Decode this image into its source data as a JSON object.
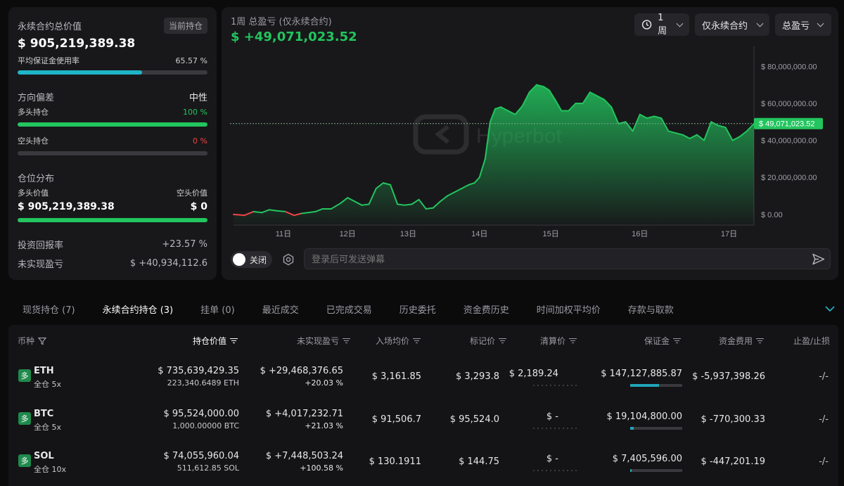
{
  "account": {
    "total_label": "永续合约总价值",
    "badge": "当前持仓",
    "total_value": "$ 905,219,389.38",
    "margin_label": "平均保证金使用率",
    "margin_pct": "65.57 %",
    "margin_fraction": 0.6557,
    "direction_label": "方向偏差",
    "direction_value": "中性",
    "long_label": "多头持仓",
    "long_pct": "100 %",
    "long_fraction": 1.0,
    "short_label": "空头持仓",
    "short_pct": "0 %",
    "short_fraction": 0.0,
    "dist_label": "仓位分布",
    "long_value_label": "多头价值",
    "short_value_label": "空头价值",
    "long_value": "$ 905,219,389.38",
    "short_value": "$ 0",
    "roi_label": "投资回报率",
    "roi_value": "+23.57 %",
    "upnl_label": "未实现盈亏",
    "upnl_value": "$ +40,934,112.6"
  },
  "chart_header": {
    "subtitle": "1周 总盈亏 (仅永续合约)",
    "value": "$ +49,071,023.52",
    "period": "1周",
    "scope": "仅永续合约",
    "metric": "总盈亏",
    "watermark": "Hyperbot",
    "current_tag": "$ 49,071,023.52"
  },
  "chart_data": {
    "type": "area",
    "ylim": [
      -5000000,
      90000000
    ],
    "yticks": [
      "$ 80,000,000.00",
      "$ 60,000,000.00",
      "$ 40,000,000.00",
      "$ 20,000,000.00",
      "$ 0.00"
    ],
    "ytick_values": [
      80000000,
      60000000,
      40000000,
      20000000,
      0
    ],
    "xticks": [
      "11日",
      "12日",
      "13日",
      "14日",
      "15日",
      "16日",
      "17日"
    ],
    "xtick_positions": [
      10.75,
      11.65,
      12.5,
      13.5,
      14.5,
      15.75,
      17.0
    ],
    "xlim": [
      10.05,
      17.35
    ],
    "x": [
      10.05,
      10.2,
      10.33,
      10.45,
      10.55,
      10.65,
      10.78,
      10.9,
      11.0,
      11.1,
      11.2,
      11.3,
      11.42,
      11.55,
      11.65,
      11.75,
      11.85,
      11.95,
      12.05,
      12.15,
      12.25,
      12.35,
      12.45,
      12.55,
      12.65,
      12.75,
      12.85,
      12.95,
      13.05,
      13.15,
      13.25,
      13.35,
      13.43,
      13.5,
      13.58,
      13.65,
      13.72,
      13.8,
      13.9,
      14.0,
      14.1,
      14.2,
      14.3,
      14.4,
      14.48,
      14.56,
      14.65,
      14.75,
      14.85,
      14.95,
      15.05,
      15.15,
      15.25,
      15.35,
      15.45,
      15.55,
      15.65,
      15.75,
      15.85,
      15.95,
      16.05,
      16.15,
      16.25,
      16.35,
      16.45,
      16.55,
      16.65,
      16.75,
      16.85,
      16.95,
      17.05,
      17.15,
      17.25,
      17.35
    ],
    "y": [
      0,
      -500,
      1500,
      1000,
      2500,
      2000,
      1500,
      -500,
      500,
      1000,
      1500,
      3000,
      3000,
      6000,
      9000,
      7000,
      5000,
      5500,
      14000,
      17000,
      16000,
      5500,
      5000,
      5500,
      8000,
      3000,
      3500,
      7000,
      10000,
      12000,
      14000,
      16000,
      17000,
      20000,
      30000,
      50000,
      57000,
      58000,
      56000,
      54000,
      58500,
      66000,
      70000,
      69000,
      67000,
      62000,
      56000,
      56000,
      60000,
      60000,
      66000,
      64000,
      62000,
      58000,
      49000,
      50000,
      45000,
      54000,
      52000,
      53000,
      52000,
      45000,
      44000,
      43000,
      41000,
      43000,
      40000,
      50000,
      48000,
      47000,
      40000,
      42000,
      45000,
      49071
    ]
  },
  "danmaku": {
    "toggle": "关闭",
    "placeholder": "登录后可发送弹幕"
  },
  "tabs": [
    "现货持仓 (7)",
    "永续合约持仓 (3)",
    "挂单 (0)",
    "最近成交",
    "已完成交易",
    "历史委托",
    "资金费历史",
    "时间加权平均价",
    "存款与取款"
  ],
  "columns": {
    "coin": "币种",
    "value": "持仓价值",
    "upnl": "未实现盈亏",
    "entry": "入场均价",
    "mark": "标记价",
    "liq": "清算价",
    "margin": "保证金",
    "funding": "资金费用",
    "tpsl": "止盈/止损"
  },
  "positions": [
    {
      "dir": "多",
      "coin": "ETH",
      "mode": "全仓 5x",
      "value": "$ 735,639,429.35",
      "size": "223,340.6489 ETH",
      "upnl": "$ +29,468,376.65",
      "upnl_pct": "+20.03 %",
      "entry": "$ 3,161.85",
      "mark": "$ 3,293.8",
      "liq": "$ 2,189.24",
      "margin": "$ 147,127,885.87",
      "margin_fill": 0.55,
      "funding": "$ -5,937,398.26",
      "tpsl": "-/-"
    },
    {
      "dir": "多",
      "coin": "BTC",
      "mode": "全仓 5x",
      "value": "$ 95,524,000.00",
      "size": "1,000.00000 BTC",
      "upnl": "$ +4,017,232.71",
      "upnl_pct": "+21.03 %",
      "entry": "$ 91,506.7",
      "mark": "$ 95,524.0",
      "liq": "$ -",
      "margin": "$ 19,104,800.00",
      "margin_fill": 0.07,
      "funding": "$ -770,300.33",
      "tpsl": "-/-"
    },
    {
      "dir": "多",
      "coin": "SOL",
      "mode": "全仓 10x",
      "value": "$ 74,055,960.04",
      "size": "511,612.85 SOL",
      "upnl": "$ +7,448,503.24",
      "upnl_pct": "+100.58 %",
      "entry": "$ 130.1911",
      "mark": "$ 144.75",
      "liq": "$ -",
      "margin": "$ 7,405,596.00",
      "margin_fill": 0.03,
      "funding": "$ -447,201.19",
      "tpsl": "-/-"
    }
  ]
}
